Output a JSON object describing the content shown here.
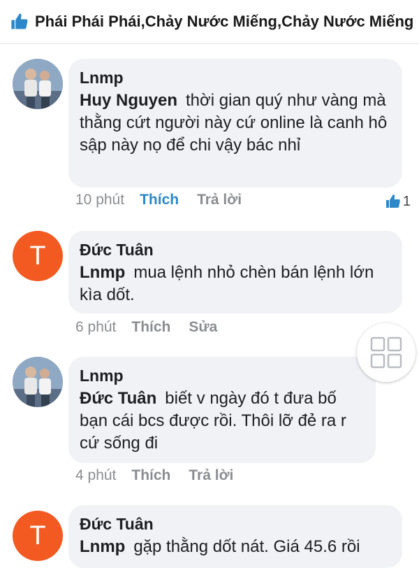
{
  "header": {
    "title": "Phái Phái Phái,Chảy Nước Miếng,Chảy Nước Miếng",
    "icon": "like-icon",
    "accent": "#2d88c9"
  },
  "comments": [
    {
      "author": "Lnmp",
      "avatar": "photo",
      "mention": "Huy Nguyen",
      "text": "thời gian quý như vàng mà thằng cứt người này cứ online là canh hô sập này nọ để chi vậy bác nhỉ",
      "time": "10 phút",
      "actions": [
        "Thích",
        "Trả lời"
      ],
      "reaction_count": "1"
    },
    {
      "author": "Đức Tuân",
      "avatar": "T",
      "mention": "Lnmp",
      "text": "mua lệnh nhỏ chèn bán lệnh lớn kìa dốt.",
      "time": "6 phút",
      "actions": [
        "Thích",
        "Sửa"
      ]
    },
    {
      "author": "Lnmp",
      "avatar": "photo",
      "mention": "Đức Tuân",
      "text": "biết v ngày đó t đưa bố bạn cái bcs được rồi. Thôi lỡ đẻ ra r cứ sống đi",
      "time": "4 phút",
      "actions": [
        "Thích",
        "Trả lời"
      ]
    },
    {
      "author": "Đức Tuân",
      "avatar": "T",
      "mention": "Lnmp",
      "text": "gặp thằng dốt nát. Giá 45.6 rồi"
    }
  ],
  "colors": {
    "avatar_letter_bg": "#f25a22",
    "bubble_bg": "#f0f2f5",
    "muted": "#8a8d91"
  }
}
